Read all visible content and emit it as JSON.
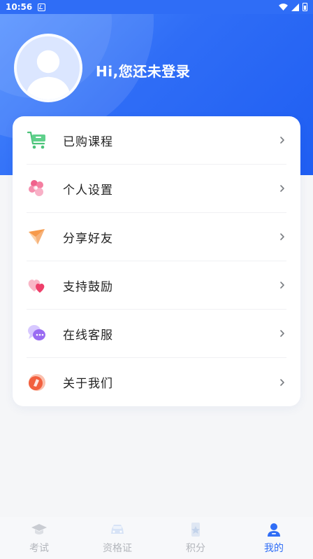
{
  "status_bar": {
    "time": "10:56"
  },
  "profile": {
    "greeting": "Hi,您还未登录"
  },
  "menu": [
    {
      "id": "purchased",
      "label": "已购课程",
      "icon": "cart-icon"
    },
    {
      "id": "settings",
      "label": "个人设置",
      "icon": "flower-settings-icon"
    },
    {
      "id": "share",
      "label": "分享好友",
      "icon": "paper-plane-icon"
    },
    {
      "id": "support",
      "label": "支持鼓励",
      "icon": "hearts-icon"
    },
    {
      "id": "service",
      "label": "在线客服",
      "icon": "chat-bubble-icon"
    },
    {
      "id": "about",
      "label": "关于我们",
      "icon": "info-circle-icon"
    }
  ],
  "tabs": [
    {
      "label": "考试",
      "icon": "graduation-cap-icon",
      "active": false
    },
    {
      "label": "资格证",
      "icon": "car-icon",
      "active": false
    },
    {
      "label": "积分",
      "icon": "star-badge-icon",
      "active": false
    },
    {
      "label": "我的",
      "icon": "user-icon",
      "active": true
    }
  ],
  "colors": {
    "primary": "#2f6df6",
    "tab_inactive": "#b3b6bc"
  }
}
